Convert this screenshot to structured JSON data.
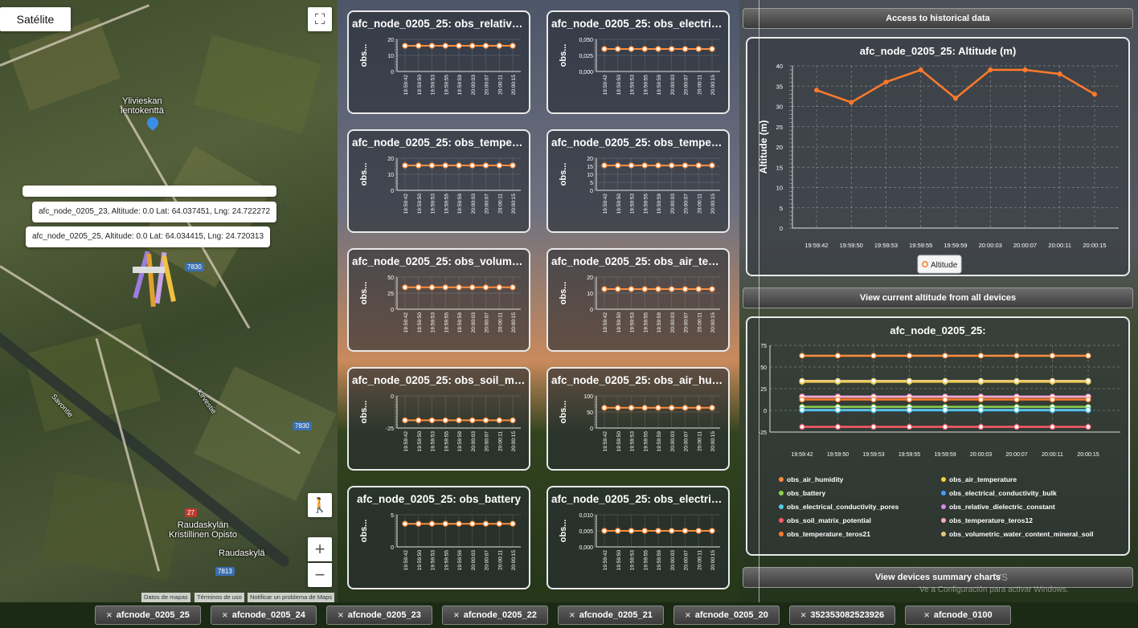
{
  "map": {
    "satellite_label": "Satélite",
    "fullscreen_glyph": "⛶",
    "zoom_in": "+",
    "zoom_out": "−",
    "pegman_glyph": "🚶",
    "places": [
      {
        "name": "Ylivieskan\nlentokenttä"
      },
      {
        "name": "Raudaskylän\nKristillinen Opisto"
      },
      {
        "name": "Raudaskylä"
      },
      {
        "name": "Savontie"
      },
      {
        "name": "Kirvestie"
      }
    ],
    "route_badges": [
      "7830",
      "7830",
      "27",
      "7813"
    ],
    "popups": [
      {
        "text": "afc_node_0205_23, Altitude: 0.0 Lat: 64.037451, Lng: 24.722272",
        "close": "×"
      },
      {
        "text": "afc_node_0205_25, Altitude: 0.0 Lat: 64.034415, Lng: 24.720313",
        "close": "×"
      }
    ],
    "attribution": [
      "Datos de mapas",
      "Términos de uso",
      "Notificar un problema de Maps"
    ]
  },
  "times": [
    "19:59:42",
    "19:59:50",
    "19:59:53",
    "19:59:55",
    "19:59:59",
    "20:00:03",
    "20:00:07",
    "20:00:11",
    "20:00:15"
  ],
  "cards": [
    {
      "title": "afc_node_0205_25: obs_relative_...",
      "ylabel": "obs...",
      "ticks": [
        "20",
        "10",
        "0"
      ],
      "ymin": 0,
      "ymax": 20,
      "value": 16,
      "color": "#ff8c3a"
    },
    {
      "title": "afc_node_0205_25: obs_electrica...",
      "ylabel": "obs...",
      "ticks": [
        "0,050",
        "0,025",
        "0,000"
      ],
      "ymin": 0,
      "ymax": 0.05,
      "value": 0.035,
      "color": "#ff8c3a"
    },
    {
      "title": "afc_node_0205_25: obs_tempera...",
      "ylabel": "obs...",
      "ticks": [
        "20",
        "10",
        "0"
      ],
      "ymin": 0,
      "ymax": 20,
      "value": 15.5,
      "color": "#ff8c3a"
    },
    {
      "title": "afc_node_0205_25: obs_tempera...",
      "ylabel": "obs...",
      "ticks": [
        "20",
        "15",
        "10",
        "5",
        "0"
      ],
      "ymin": 0,
      "ymax": 20,
      "value": 15.5,
      "color": "#ff8c3a"
    },
    {
      "title": "afc_node_0205_25: obs_volumet...",
      "ylabel": "obs...",
      "ticks": [
        "50",
        "25",
        "0"
      ],
      "ymin": 0,
      "ymax": 50,
      "value": 34,
      "color": "#ff8c3a"
    },
    {
      "title": "afc_node_0205_25: obs_air_tem...",
      "ylabel": "obs...",
      "ticks": [
        "20",
        "10",
        "0"
      ],
      "ymin": 0,
      "ymax": 20,
      "value": 12.5,
      "color": "#ff8c3a"
    },
    {
      "title": "afc_node_0205_25: obs_soil_mat...",
      "ylabel": "obs...",
      "ticks": [
        "0",
        "-25"
      ],
      "ymin": -25,
      "ymax": 0,
      "value": -19,
      "color": "#ff8c3a"
    },
    {
      "title": "afc_node_0205_25: obs_air_hum...",
      "ylabel": "obs...",
      "ticks": [
        "100",
        "50",
        "0"
      ],
      "ymin": 0,
      "ymax": 100,
      "value": 63,
      "color": "#ff8c3a"
    },
    {
      "title": "afc_node_0205_25: obs_battery",
      "ylabel": "obs...",
      "ticks": [
        "5",
        "0"
      ],
      "ymin": 0,
      "ymax": 5,
      "value": 3.6,
      "color": "#ff8c3a"
    },
    {
      "title": "afc_node_0205_25: obs_electrica...",
      "ylabel": "obs...",
      "ticks": [
        "0,010",
        "0,005",
        "0,000"
      ],
      "ymin": 0,
      "ymax": 0.01,
      "value": 0.005,
      "color": "#ff8c3a"
    }
  ],
  "buttons": {
    "historical": "Access to historical data",
    "current_altitude": "View current altitude from all devices",
    "summary": "View devices summary charts"
  },
  "chart_data": [
    {
      "type": "line",
      "title": "afc_node_0205_25: Altitude (m)",
      "xlabel": "",
      "ylabel": "Altitude (m)",
      "x": [
        "19:59:42",
        "19:59:50",
        "19:59:53",
        "19:59:55",
        "19:59:59",
        "20:00:03",
        "20:00:07",
        "20:00:11",
        "20:00:15"
      ],
      "ylim": [
        0,
        40
      ],
      "yticks": [
        "0",
        "5",
        "10",
        "15",
        "20",
        "25",
        "30",
        "35",
        "40"
      ],
      "series": [
        {
          "name": "Altitude",
          "values": [
            34,
            31,
            36,
            39,
            32,
            39,
            39,
            38,
            33
          ],
          "color": "#ff7a2a"
        }
      ],
      "grid": true,
      "legend": "bottom"
    },
    {
      "type": "line",
      "title": "afc_node_0205_25:",
      "x": [
        "19:59:42",
        "19:59:50",
        "19:59:53",
        "19:59:55",
        "19:59:59",
        "20:00:03",
        "20:00:07",
        "20:00:11",
        "20:00:15"
      ],
      "ylim": [
        -25,
        75
      ],
      "yticks": [
        "75",
        "50",
        "25",
        "0",
        "-25"
      ],
      "grid": true,
      "legend": "bottom",
      "series": [
        {
          "name": "obs_air_humidity",
          "values": [
            63,
            63,
            63,
            63,
            63,
            63,
            63,
            63,
            63
          ],
          "color": "#ff8c3a"
        },
        {
          "name": "obs_air_temperature",
          "values": [
            33,
            33,
            33,
            33,
            33,
            33,
            33,
            33,
            33
          ],
          "color": "#f5d23a"
        },
        {
          "name": "obs_battery",
          "values": [
            4,
            4,
            4,
            4,
            4,
            4,
            4,
            4,
            4
          ],
          "color": "#8fd14f"
        },
        {
          "name": "obs_electrical_conductivity_bulk",
          "values": [
            0,
            0,
            0,
            0,
            0,
            0,
            0,
            0,
            0
          ],
          "color": "#3aa0ff"
        },
        {
          "name": "obs_electrical_conductivity_pores",
          "values": [
            0.5,
            0.5,
            0.5,
            0.5,
            0.5,
            0.5,
            0.5,
            0.5,
            0.5
          ],
          "color": "#5bc8e8"
        },
        {
          "name": "obs_relative_dielectric_constant",
          "values": [
            16,
            16,
            16,
            16,
            16,
            16,
            16,
            16,
            16
          ],
          "color": "#d88ae8"
        },
        {
          "name": "obs_soil_matrix_potential",
          "values": [
            -19,
            -19,
            -19,
            -19,
            -19,
            -19,
            -19,
            -19,
            -19
          ],
          "color": "#ff5a6a"
        },
        {
          "name": "obs_temperature_teros12",
          "values": [
            15.5,
            15.5,
            15.5,
            15.5,
            15.5,
            15.5,
            15.5,
            15.5,
            15.5
          ],
          "color": "#ffa8c0"
        },
        {
          "name": "obs_temperature_teros21",
          "values": [
            12.5,
            12.5,
            12.5,
            12.5,
            12.5,
            12.5,
            12.5,
            12.5,
            12.5
          ],
          "color": "#ff7a2a"
        },
        {
          "name": "obs_volumetric_water_content_mineral_soil",
          "values": [
            34,
            34,
            34,
            34,
            34,
            34,
            34,
            34,
            34
          ],
          "color": "#e8c878"
        }
      ]
    }
  ],
  "tabs": [
    {
      "label": "afcnode_0205_25",
      "close": "✕"
    },
    {
      "label": "afcnode_0205_24",
      "close": "✕"
    },
    {
      "label": "afcnode_0205_23",
      "close": "✕"
    },
    {
      "label": "afcnode_0205_22",
      "close": "✕"
    },
    {
      "label": "afcnode_0205_21",
      "close": "✕"
    },
    {
      "label": "afcnode_0205_20",
      "close": "✕"
    },
    {
      "label": "352353082523926",
      "close": "✕"
    },
    {
      "label": "afcnode_0100",
      "close": "✕"
    }
  ],
  "watermark": {
    "line1": "VS",
    "line2": "Ve a Configuración para activar Windows."
  }
}
